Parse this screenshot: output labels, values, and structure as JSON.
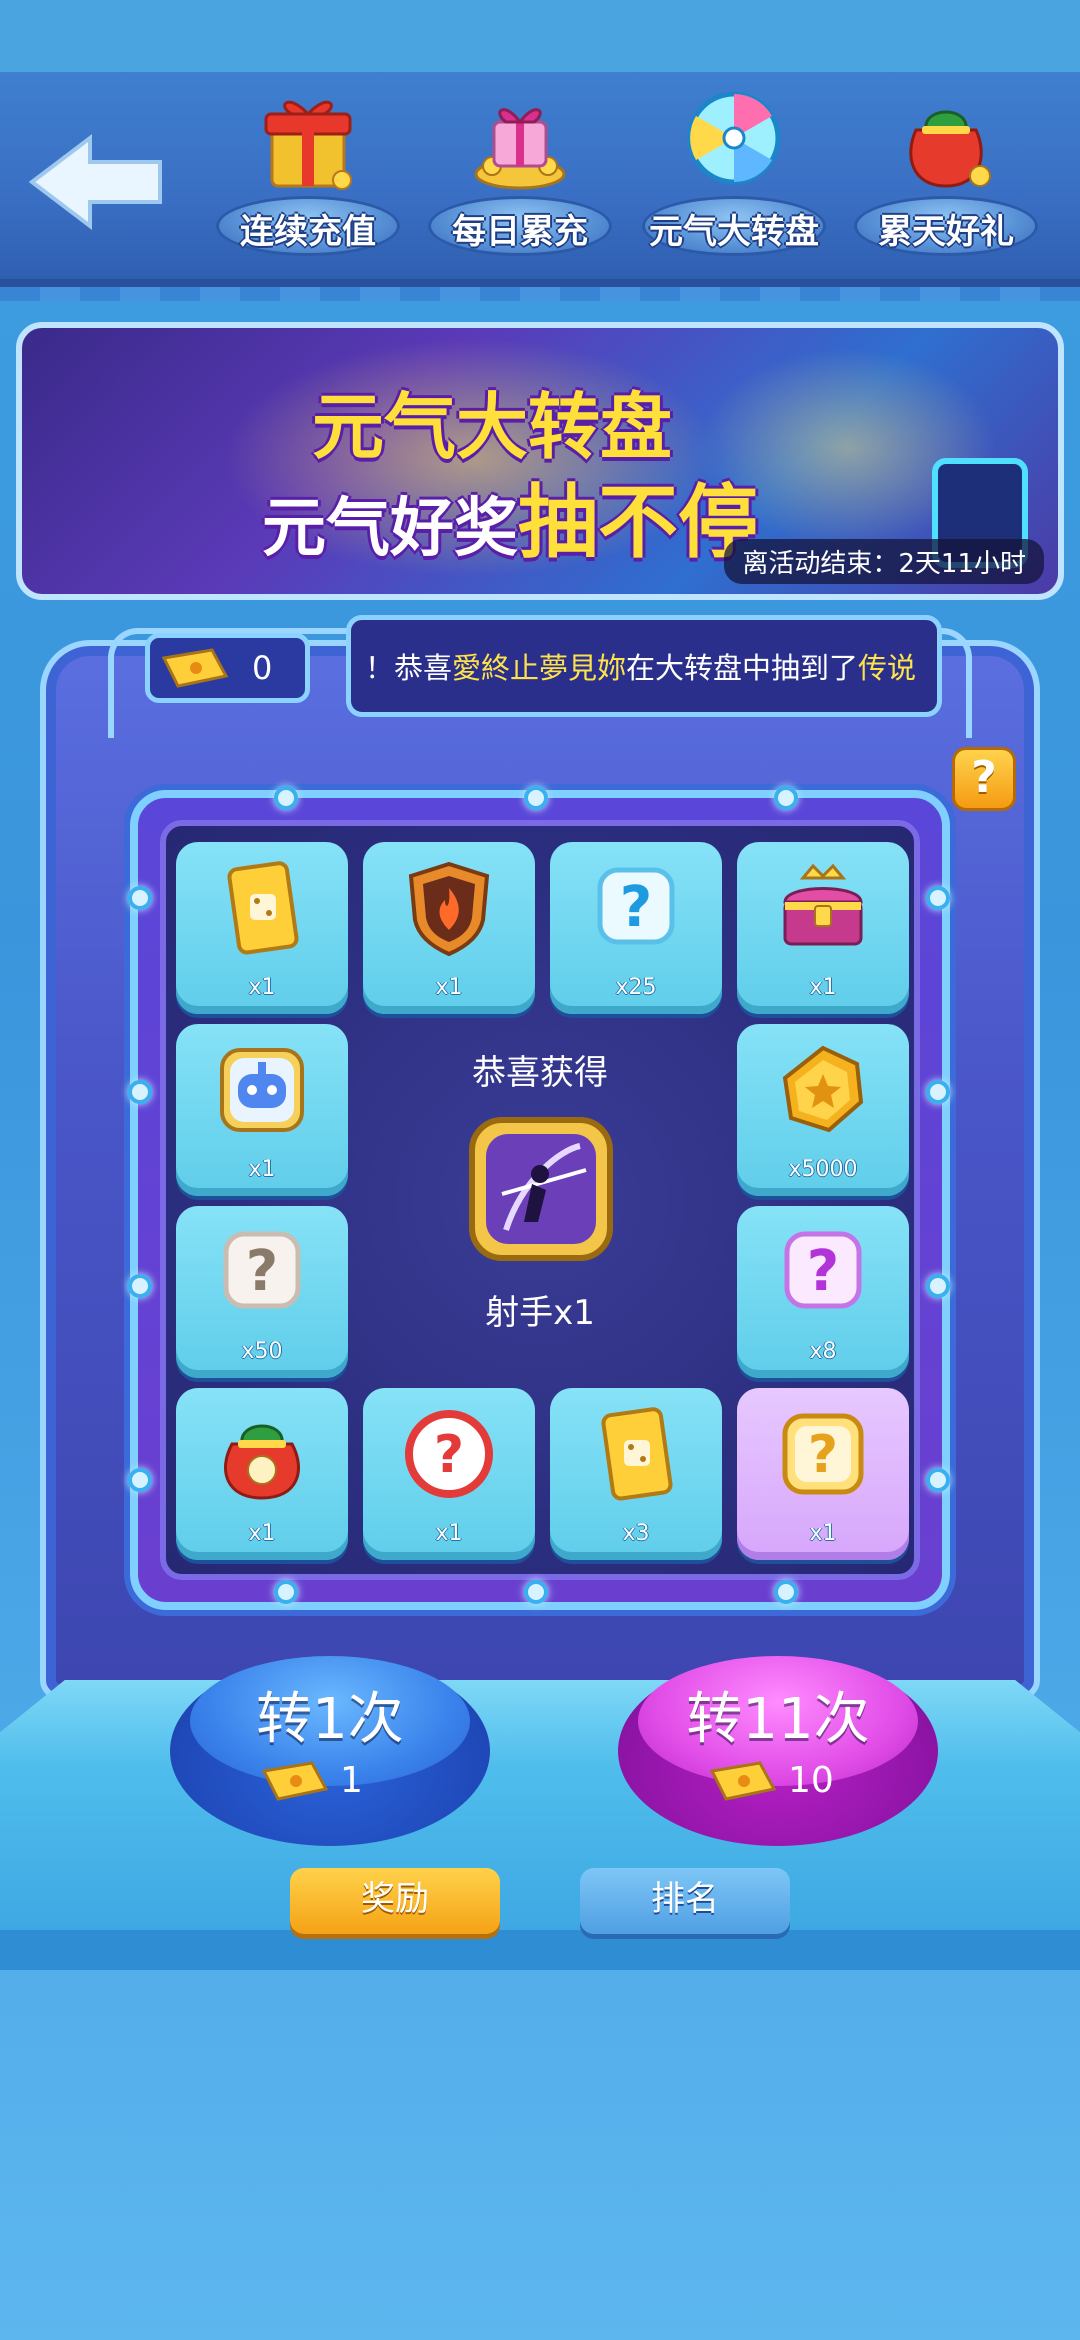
{
  "nav": {
    "tabs": [
      {
        "label": "连续充值",
        "icon": "gift-box-icon"
      },
      {
        "label": "每日累充",
        "icon": "gift-gold-icon"
      },
      {
        "label": "元气大转盘",
        "icon": "wheel-icon"
      },
      {
        "label": "累天好礼",
        "icon": "lucky-bag-icon"
      }
    ],
    "back_icon": "back-arrow-icon"
  },
  "banner": {
    "title_line1": "元气大转盘",
    "title_line2_prefix": "元气好奖",
    "title_line2_highlight": "抽不停",
    "countdown": "离活动结束：2天11小时"
  },
  "tickets": {
    "count": "0"
  },
  "ticker": {
    "prefix": "！恭喜",
    "player": "愛終止夢見妳",
    "middle": "在大转盘中抽到了",
    "item": "传说"
  },
  "help_label": "?",
  "grid": [
    {
      "icon": "dice-card-icon",
      "qty": "x1"
    },
    {
      "icon": "fire-shield-icon",
      "qty": "x1"
    },
    {
      "icon": "mystery-blue-icon",
      "qty": "x25"
    },
    {
      "icon": "treasure-chest-icon",
      "qty": "x1"
    },
    {
      "icon": "robot-avatar-icon",
      "qty": "x1"
    },
    {
      "icon": "gold-coin-icon",
      "qty": "x5000"
    },
    {
      "icon": "mystery-white-icon",
      "qty": "x50"
    },
    {
      "icon": "mystery-purple-icon",
      "qty": "x8"
    },
    {
      "icon": "lucky-bag-select-icon",
      "qty": "x1"
    },
    {
      "icon": "mystery-red-icon",
      "qty": "x1"
    },
    {
      "icon": "dice-card-icon",
      "qty": "x3"
    },
    {
      "icon": "mystery-gold-icon",
      "qty": "x1"
    }
  ],
  "center": {
    "title": "恭喜获得",
    "reward_label": "射手x1",
    "reward_icon": "archer-icon"
  },
  "spin": {
    "once": {
      "label": "转1次",
      "cost": "1"
    },
    "eleven": {
      "label": "转11次",
      "cost": "10"
    }
  },
  "buttons": {
    "reward": "奖励",
    "rank": "排名"
  }
}
